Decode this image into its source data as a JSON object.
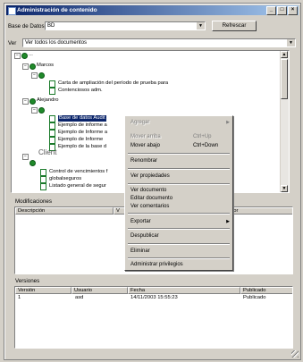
{
  "window": {
    "title": "Administración de contenido",
    "min_label": "_",
    "max_label": "□",
    "close_label": "×"
  },
  "toolbar": {
    "db_label": "Base de Datos",
    "db_value": "BD",
    "refresh_button": "Refrescar",
    "view_label": "Ver",
    "view_value": "Ver todos los documentos"
  },
  "tree": {
    "root_cut": "...",
    "nodes": [
      {
        "label": "Marcos"
      },
      {
        "label": "Carta de ampliación del período de prueba para"
      },
      {
        "label": "Contenciosos adm."
      },
      {
        "label": "Alejandro"
      },
      {
        "label": "Base de datos Audit"
      },
      {
        "label": "Ejemplo de informe a"
      },
      {
        "label": "Ejemplo de Informe a"
      },
      {
        "label": "Ejemplo de Informe"
      },
      {
        "label": "Ejemplo de la base d"
      },
      {
        "label": "Client"
      },
      {
        "label": "Control de vencimientos f"
      },
      {
        "label": "globalseguros"
      },
      {
        "label": "Listado general de segur"
      }
    ]
  },
  "modificaciones": {
    "title": "Modificaciones",
    "headers": [
      "Descripción",
      "V",
      "lor"
    ]
  },
  "versiones": {
    "title": "Versiones",
    "headers": [
      "Versión",
      "Usuario",
      "Fecha",
      "Publicado"
    ],
    "rows": [
      {
        "version": "1",
        "usuario": "asd",
        "fecha": "14/11/2003 15:55:23",
        "publicado": "Publicado"
      }
    ]
  },
  "context_menu": {
    "items": [
      {
        "label": "Agregar",
        "shortcut": "",
        "disabled": true,
        "submenu": true
      },
      {
        "label": "Mover arriba",
        "shortcut": "Ctrl+Up",
        "disabled": true
      },
      {
        "label": "Mover abajo",
        "shortcut": "Ctrl+Down",
        "disabled": false
      },
      {
        "label": "Renombrar",
        "shortcut": "",
        "disabled": false
      },
      {
        "label": "Ver propiedades",
        "shortcut": "",
        "disabled": false
      },
      {
        "label": "Ver documento",
        "shortcut": "",
        "disabled": false
      },
      {
        "label": "Editar documento",
        "shortcut": "",
        "disabled": false
      },
      {
        "label": "Ver comentarios",
        "shortcut": "",
        "disabled": false
      },
      {
        "label": "Exportar",
        "shortcut": "",
        "disabled": false,
        "submenu": true
      },
      {
        "label": "Despublicar",
        "shortcut": "",
        "disabled": false
      },
      {
        "label": "Eliminar",
        "shortcut": "",
        "disabled": false
      },
      {
        "label": "Administrar privilegios",
        "shortcut": "",
        "disabled": false
      }
    ]
  },
  "colors": {
    "titlebar": "#0a246a",
    "selection": "#0a246a",
    "doc_icon": "#1f8a2a",
    "face": "#d4d0c8"
  }
}
